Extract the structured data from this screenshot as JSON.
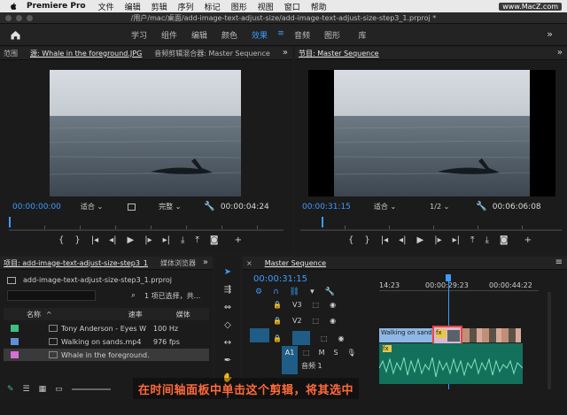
{
  "menubar": {
    "app_name": "Premiere Pro",
    "items": [
      "文件",
      "编辑",
      "剪辑",
      "序列",
      "标记",
      "图形",
      "视图",
      "窗口",
      "帮助"
    ],
    "watermark": "www.MacZ.com"
  },
  "titlebar": {
    "title": "/用户/mac/桌面/add-image-text-adjust-size/add-image-text-adjust-size-step3_1.prproj *"
  },
  "workspace": {
    "tabs": [
      "学习",
      "组件",
      "编辑",
      "颜色",
      "效果",
      "音频",
      "图形",
      "库"
    ],
    "active_tab": "效果"
  },
  "source_panel": {
    "left_label": "范围",
    "tab_source": "源: Whale in the foreground.JPG",
    "tab_mixer": "音频剪辑混合器: Master Sequence",
    "timecode_in": "00:00:00:00",
    "fit": "适合",
    "quality": "完整",
    "timecode_dur": "00:00:04:24"
  },
  "program_panel": {
    "tab": "节目: Master Sequence",
    "timecode_in": "00:00:31:15",
    "fit": "适合",
    "quality": "1/2",
    "timecode_dur": "00:06:06:08"
  },
  "project_panel": {
    "tab_project": "项目: add-image-text-adjust-size-step3_1",
    "tab_media": "媒体浏览器",
    "file_name": "add-image-text-adjust-size-step3_1.prproj",
    "selection": "1 项已选择，共...",
    "col_name": "名称",
    "col_rate": "速率",
    "col_media": "媒体",
    "items": [
      {
        "name": "Tony Anderson - Eyes W",
        "rate": "100 Hz",
        "color": "#3fbf7f"
      },
      {
        "name": "Walking on sands.mp4",
        "rate": "976 fps",
        "color": "#5f8fd6"
      },
      {
        "name": "Whale in the foreground.",
        "rate": "",
        "color": "#d56ed6"
      }
    ]
  },
  "timeline": {
    "tab": "Master Sequence",
    "timecode": "00:00:31:15",
    "ruler": [
      "14:23",
      "00:00:29:23",
      "00:00:44:22"
    ],
    "tracks": [
      "V3",
      "V2",
      "V1",
      "A1"
    ],
    "audio_label": "音频 1",
    "clip_name": "Walking on sands.mp4",
    "fx": "fx"
  },
  "caption": "在时间轴面板中单击这个剪辑，将其选中",
  "colors": {
    "accent": "#3a9cff",
    "highlight": "#e8463a",
    "audio": "#1f8f6f"
  }
}
